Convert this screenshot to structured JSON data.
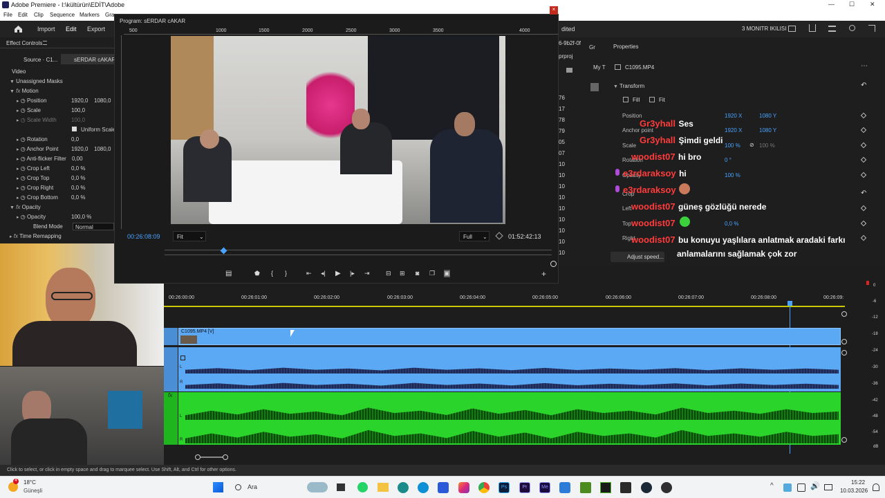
{
  "window": {
    "title": "Adobe Premiere - I:\\kültürün\\EDİT\\Adobe",
    "minimize": "—",
    "maximize": "☐",
    "close": "✕"
  },
  "menu": [
    "File",
    "Edit",
    "Clip",
    "Sequence",
    "Markers",
    "Gra"
  ],
  "header": {
    "tabs": [
      "Import",
      "Edit",
      "Export"
    ],
    "edited": "dited",
    "workspace": "3 MONITR IKILISI"
  },
  "effect_controls": {
    "panel_title": "Effect Controls",
    "source_label": "Source · C1...",
    "seq_label": "sERDAR cAKAR ·",
    "video": "Video",
    "rows": [
      {
        "label": "Unassigned Masks",
        "v1": "",
        "v2": ""
      },
      {
        "label": "Motion",
        "v1": "",
        "v2": ""
      },
      {
        "label": "Position",
        "v1": "1920,0",
        "v2": "1080,0"
      },
      {
        "label": "Scale",
        "v1": "100,0",
        "v2": ""
      },
      {
        "label": "Scale Width",
        "v1": "100,0",
        "v2": ""
      },
      {
        "label": "Uniform Scale",
        "v1": "",
        "v2": ""
      },
      {
        "label": "Rotation",
        "v1": "0,0",
        "v2": ""
      },
      {
        "label": "Anchor Point",
        "v1": "1920,0",
        "v2": "1080,0"
      },
      {
        "label": "Anti-flicker Filter",
        "v1": "0,00",
        "v2": ""
      },
      {
        "label": "Crop Left",
        "v1": "0,0 %",
        "v2": ""
      },
      {
        "label": "Crop Top",
        "v1": "0,0 %",
        "v2": ""
      },
      {
        "label": "Crop Right",
        "v1": "0,0 %",
        "v2": ""
      },
      {
        "label": "Crop Bottom",
        "v1": "0,0 %",
        "v2": ""
      },
      {
        "label": "Opacity",
        "v1": "",
        "v2": ""
      },
      {
        "label": "Opacity",
        "v1": "100,0 %",
        "v2": ""
      },
      {
        "label": "Blend Mode",
        "v1": "Normal",
        "v2": ""
      },
      {
        "label": "Time Remapping",
        "v1": "",
        "v2": ""
      }
    ]
  },
  "program": {
    "title": "Program: sERDAR cAKAR",
    "ruler": [
      "500",
      "1000",
      "1500",
      "2000",
      "2500",
      "3000",
      "3500",
      "4000"
    ],
    "timecode": "00:26:08:09",
    "fit": "Fit",
    "full": "Full",
    "duration": "01:52:42:13"
  },
  "project_strip": {
    "items": [
      "6-9b2f-0f",
      "prproj",
      "76",
      "17",
      "78",
      "79",
      "05",
      "07",
      "10",
      "10",
      "10",
      "10",
      "10",
      "10",
      "10",
      "10",
      "10"
    ]
  },
  "properties": {
    "panel_title": "Properties",
    "tab_gr": "Gr",
    "tab_my": "My T",
    "clip": "C1095.MP4",
    "transform": "Transform",
    "fill": "Fill",
    "fit": "Fit",
    "labels": [
      "Position",
      "Anchor point",
      "Scale",
      "Rotation",
      "Opacity",
      "Crop",
      "Left",
      "Top",
      "Right"
    ],
    "pos_x": "1920 X",
    "pos_y": "1080 Y",
    "anc_x": "1920 X",
    "anc_y": "1080 Y",
    "scale": "100 %",
    "scale2": "100 %",
    "rotation": "0 °",
    "opacity": "100 %",
    "top": "0,0 %",
    "adjust": "Adjust speed..."
  },
  "chat": [
    {
      "user": "Gr3yhall",
      "msg": "Ses"
    },
    {
      "user": "Gr3yhall",
      "msg": "Şimdi geldi"
    },
    {
      "user": "woodist07",
      "msg": "hi bro"
    },
    {
      "user": "e3rdaraksoy",
      "msg": "hi"
    },
    {
      "user": "e3rdaraksoy",
      "msg": ""
    },
    {
      "user": "woodist07",
      "msg": "güneş gözlüğü nerede"
    },
    {
      "user": "woodist07",
      "msg": ""
    },
    {
      "user": "woodist07",
      "msg": "bu konuyu yaşlılara anlatmak aradaki farkı"
    },
    {
      "user": "",
      "msg": "anlamalarını sağlamak çok zor"
    }
  ],
  "timeline": {
    "ruler": [
      "00:26:00:00",
      "00:26:01:00",
      "00:26:02:00",
      "00:26:03:00",
      "00:26:04:00",
      "00:26:05:00",
      "00:26:06:00",
      "00:26:07:00",
      "00:26:08:00",
      "00:26:09:"
    ],
    "clip_name": "C1095.MP4 [V]",
    "track_l": "L",
    "track_r": "R",
    "fx": "fx",
    "meter": [
      "0",
      "-6",
      "-12",
      "-18",
      "-24",
      "-30",
      "-36",
      "-42",
      "-48",
      "-54",
      "dB"
    ]
  },
  "status": {
    "text": "Click to select, or click in empty space and drag to marquee select. Use Shift, Alt, and Ctrl for other options."
  },
  "taskbar": {
    "weather_temp": "18°C",
    "weather_loc": "Güneşli",
    "search": "Ara",
    "time": "15:22",
    "date": "10.03.2026",
    "badge_a": "4"
  },
  "colors": {
    "accent": "#4aa3ff",
    "video_track": "#5ba8f5",
    "audio2": "#2bd42b",
    "chat_user": "#ff3b3b"
  }
}
